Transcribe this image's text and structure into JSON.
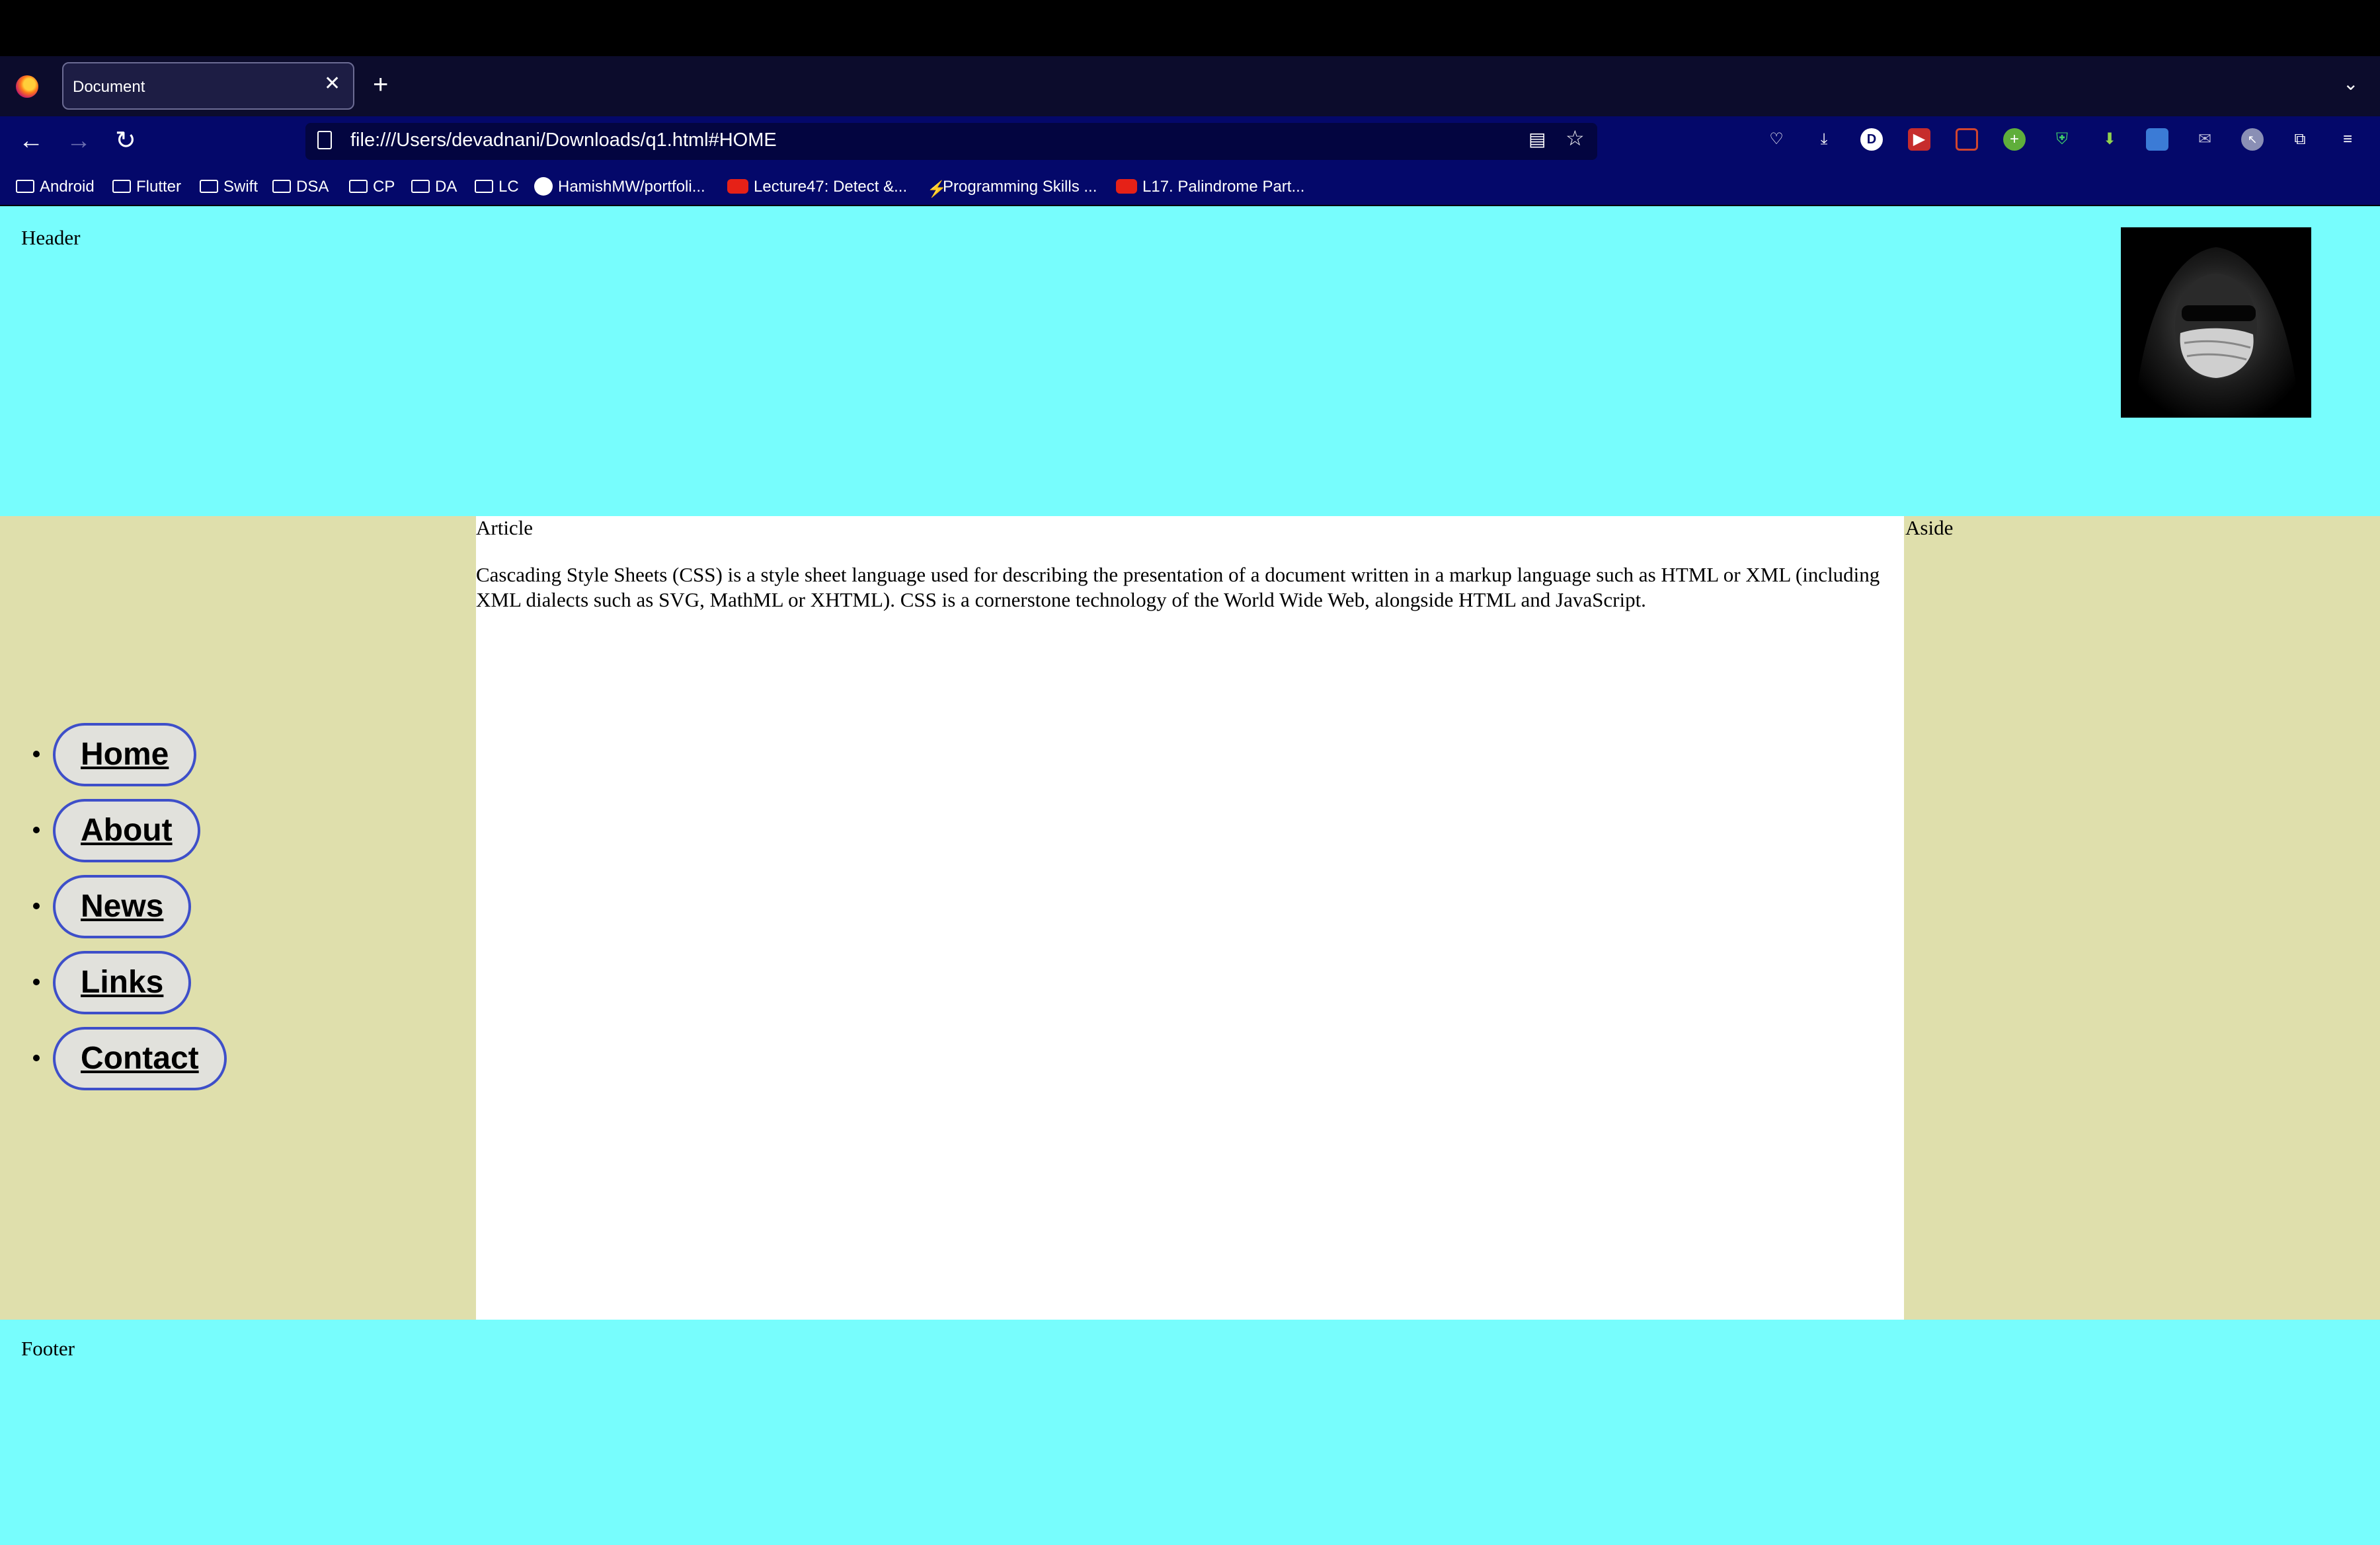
{
  "browser": {
    "tab_title": "Document",
    "tab_close": "✕",
    "new_tab": "+",
    "url": "file:///Users/devadnani/Downloads/q1.html#HOME",
    "bookmarks": [
      {
        "label": "Android",
        "icon": "folder-icon"
      },
      {
        "label": "Flutter",
        "icon": "folder-icon"
      },
      {
        "label": "Swift",
        "icon": "folder-icon"
      },
      {
        "label": "DSA",
        "icon": "folder-icon"
      },
      {
        "label": "CP",
        "icon": "folder-icon"
      },
      {
        "label": "DA",
        "icon": "folder-icon"
      },
      {
        "label": "LC",
        "icon": "folder-icon"
      },
      {
        "label": "HamishMW/portfoli...",
        "icon": "github-icon"
      },
      {
        "label": "Lecture47: Detect &...",
        "icon": "youtube-icon"
      },
      {
        "label": "Programming Skills ...",
        "icon": "site-icon"
      },
      {
        "label": "L17. Palindrome Part...",
        "icon": "youtube-icon"
      }
    ],
    "toolbar_badge": "D"
  },
  "page": {
    "header_label": "Header",
    "article_label": "Article",
    "article_text": "Cascading Style Sheets (CSS) is a style sheet language used for describing the presentation of a document written in a markup language such as HTML or XML (including XML dialects such as SVG, MathML or XHTML). CSS is a cornerstone technology of the World Wide Web, alongside HTML and JavaScript.",
    "aside_label": "Aside",
    "footer_label": "Footer",
    "nav_items": [
      "Home",
      "About",
      "News",
      "Links",
      "Contact"
    ]
  },
  "colors": {
    "header_footer_bg": "#77fdfd",
    "side_bg": "#dfdfac",
    "pill_border": "#3e4fc9",
    "chrome_bg": "#04086a"
  }
}
